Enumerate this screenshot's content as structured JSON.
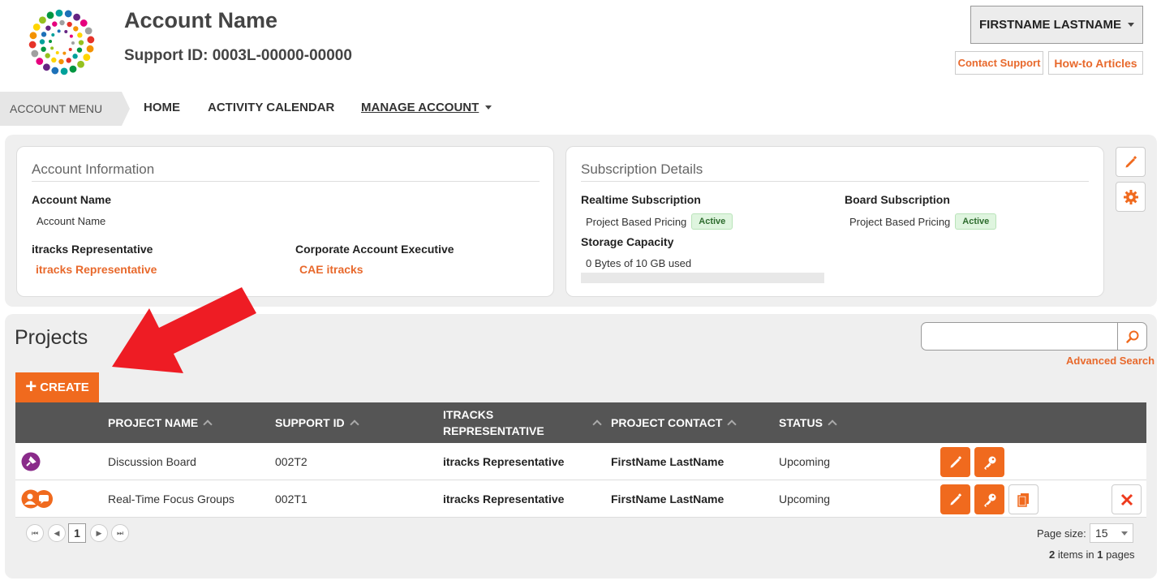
{
  "header": {
    "account_title": "Account Name",
    "support_id": "Support ID: 0003L-00000-00000",
    "user_name": "FIRSTNAME LASTNAME",
    "contact_support": "Contact Support",
    "howto_articles": "How-to Articles"
  },
  "nav": {
    "account_menu": "ACCOUNT MENU",
    "home": "HOME",
    "activity_calendar": "ACTIVITY CALENDAR",
    "manage_account": "MANAGE ACCOUNT"
  },
  "account_info": {
    "title": "Account Information",
    "account_name_label": "Account Name",
    "account_name_value": "Account Name",
    "rep_label": "itracks Representative",
    "rep_value": "itracks Representative",
    "cae_label": "Corporate Account Executive",
    "cae_value": "CAE itracks"
  },
  "subscription": {
    "title": "Subscription Details",
    "realtime_label": "Realtime Subscription",
    "realtime_plan": "Project Based Pricing",
    "realtime_status": "Active",
    "board_label": "Board Subscription",
    "board_plan": "Project Based Pricing",
    "board_status": "Active",
    "storage_label": "Storage Capacity",
    "storage_value": "0 Bytes of 10 GB used",
    "storage_used_fraction": 0
  },
  "projects": {
    "title": "Projects",
    "create_label": "CREATE",
    "advanced_search": "Advanced Search",
    "search_value": "",
    "columns": {
      "project_name": "PROJECT NAME",
      "support_id": "SUPPORT ID",
      "rep": "ITRACKS REPRESENTATIVE",
      "contact": "PROJECT CONTACT",
      "status": "STATUS"
    },
    "rows": [
      {
        "name": "Discussion Board",
        "support_id": "002T2",
        "rep": "itracks Representative",
        "contact": "FirstName LastName",
        "status": "Upcoming",
        "icon": "pushpin-icon"
      },
      {
        "name": "Real-Time Focus Groups",
        "support_id": "002T1",
        "rep": "itracks Representative",
        "contact": "FirstName LastName",
        "status": "Upcoming",
        "icon": "focus-group-icon"
      }
    ]
  },
  "pager": {
    "current_page": "1",
    "page_size_label": "Page size:",
    "page_size": "15",
    "items_count": "2",
    "items_mid": "items in",
    "pages_count": "1",
    "pages_suffix": "pages"
  },
  "colors": {
    "accent": "#f06a1e",
    "link": "#e8692c",
    "header_bg": "#555555",
    "badge_bg": "#dff5df",
    "arrow": "#ee1c24"
  }
}
